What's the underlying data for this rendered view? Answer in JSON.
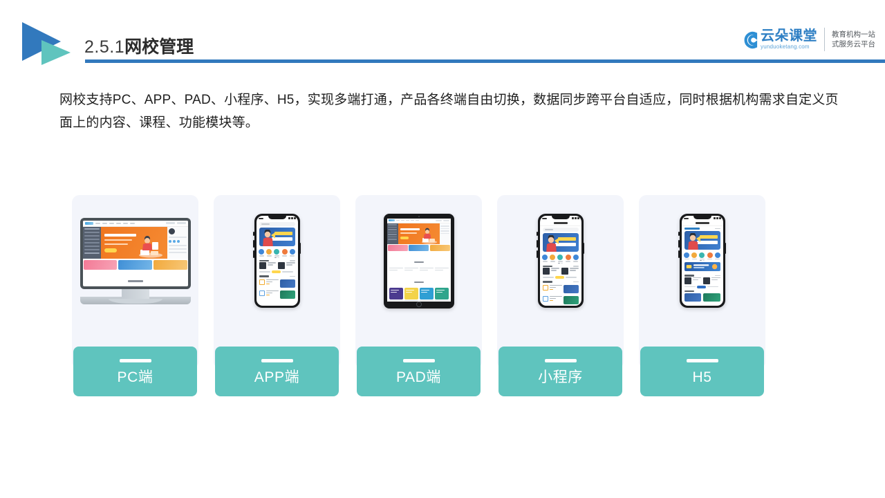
{
  "header": {
    "section_number": "2.5.1",
    "title": "网校管理",
    "accent_blue": "#3279bd",
    "accent_teal": "#5fc4be",
    "arrow_icon": "play-triangle-logo"
  },
  "brand": {
    "name_cn": "云朵课堂",
    "url": "yunduoketang.com",
    "tagline_line1": "教育机构一站",
    "tagline_line2": "式服务云平台",
    "cloud_icon": "cloud-icon",
    "brand_color": "#2e7fc4"
  },
  "intro": {
    "paragraph": "网校支持PC、APP、PAD、小程序、H5，实现多端打通，产品各终端自由切换，数据同步跨平台自适应，同时根据机构需求自定义页面上的内容、课程、功能模块等。"
  },
  "cards": [
    {
      "label": "PC端",
      "device": "desktop-monitor",
      "icon": "desktop-icon"
    },
    {
      "label": "APP端",
      "device": "smartphone",
      "icon": "mobile-icon"
    },
    {
      "label": "PAD端",
      "device": "tablet",
      "icon": "tablet-icon"
    },
    {
      "label": "小程序",
      "device": "smartphone-miniapp",
      "icon": "mobile-icon"
    },
    {
      "label": "H5",
      "device": "smartphone-h5",
      "icon": "mobile-icon"
    }
  ],
  "theme": {
    "card_background": "#f3f5fb",
    "label_background": "#5fc4be",
    "label_text_color": "#ffffff",
    "page_background": "#ffffff",
    "banner_orange": "#f0761f",
    "banner_blue": "#2d5fa8"
  }
}
